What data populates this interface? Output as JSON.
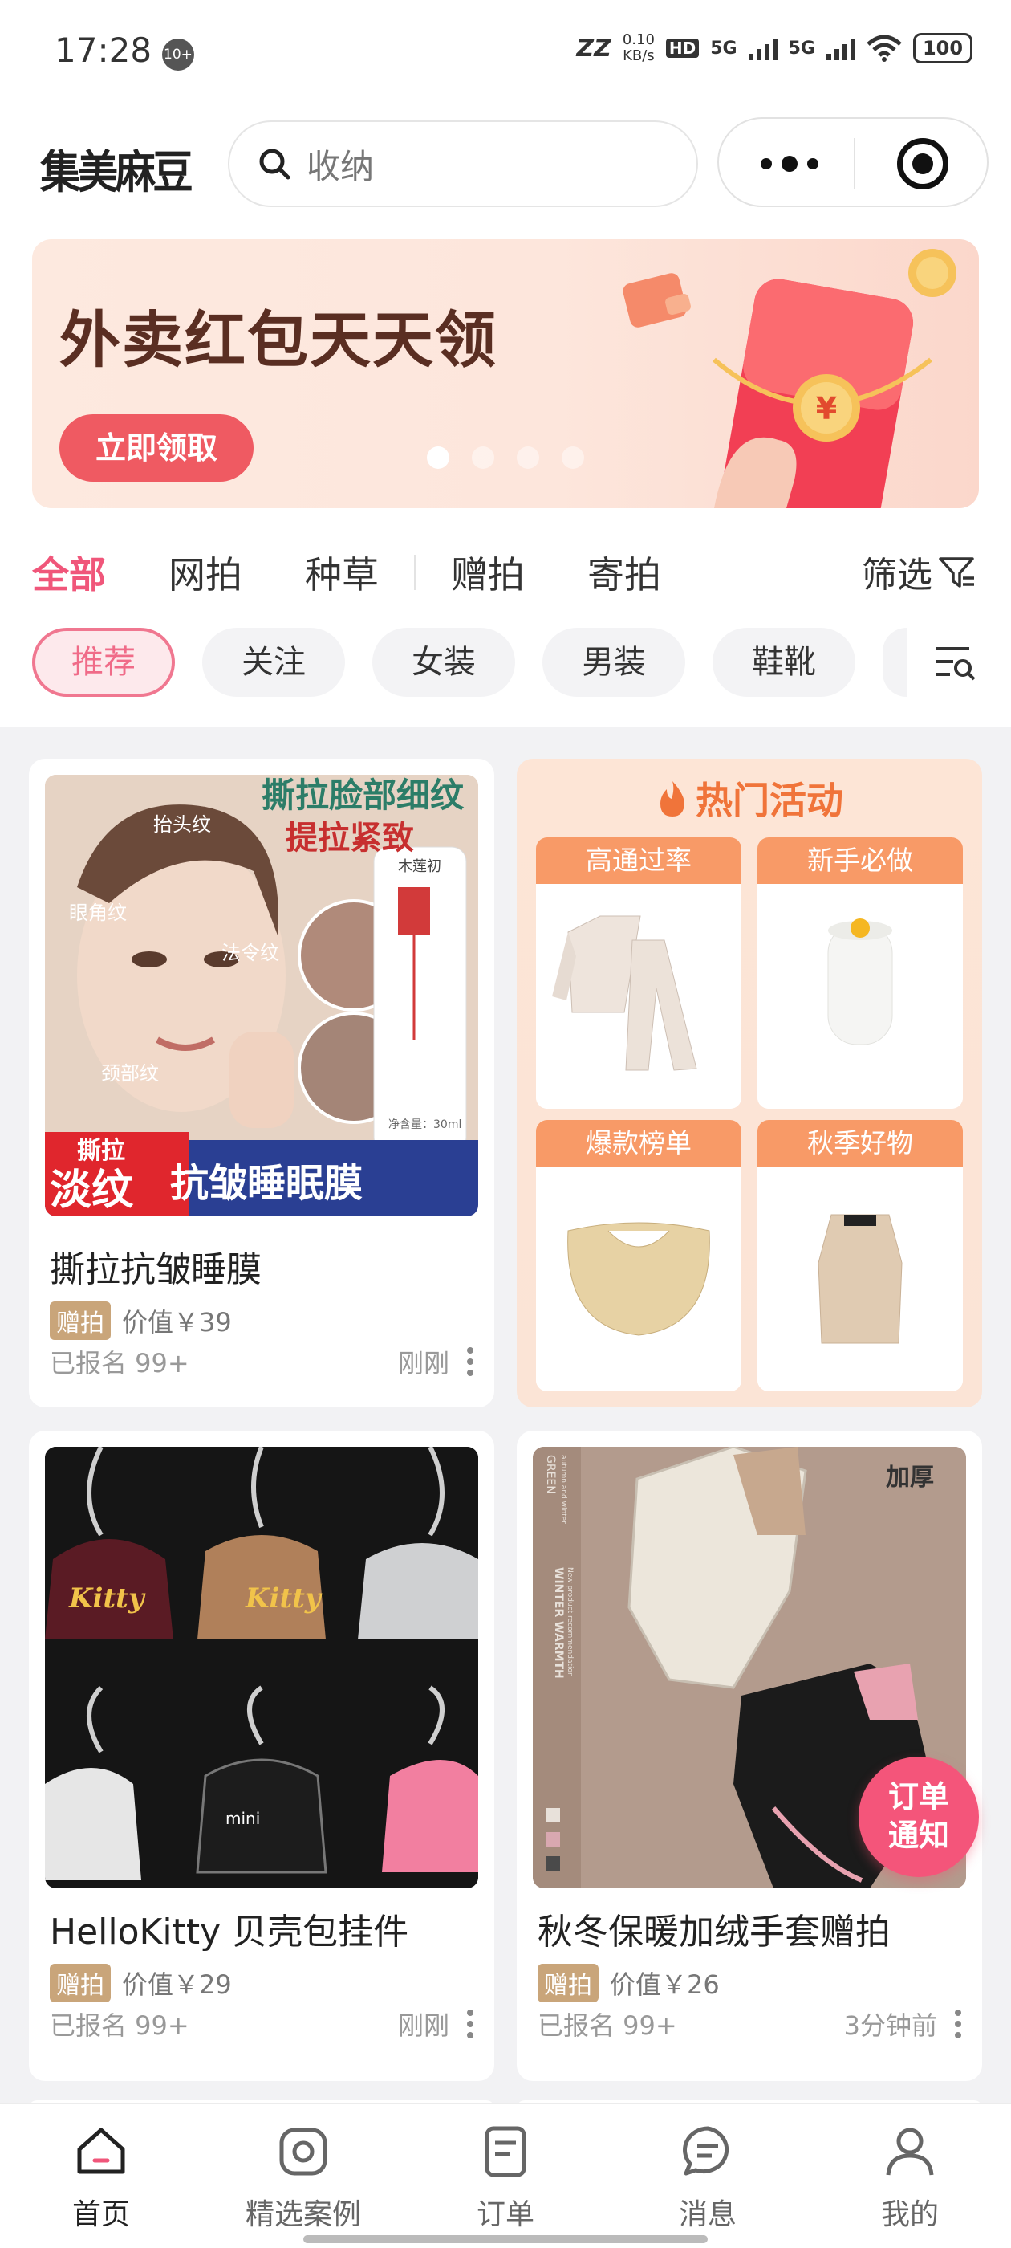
{
  "status_bar": {
    "time": "17:28",
    "notification_badge": "10+",
    "net_speed_value": "0.10",
    "net_speed_unit": "KB/s",
    "hd_label": "HD",
    "signal_1": "5G",
    "signal_2": "5G",
    "battery": "100"
  },
  "header": {
    "logo": "集美麻豆",
    "search_placeholder": "收纳"
  },
  "banner": {
    "title": "外卖红包天天领",
    "button": "立即领取",
    "active_index": 0,
    "dot_count": 4
  },
  "tabs": [
    "全部",
    "网拍",
    "种草",
    "赠拍",
    "寄拍"
  ],
  "filter_label": "筛选",
  "chips": [
    "推荐",
    "关注",
    "女装",
    "男装",
    "鞋靴"
  ],
  "product_1": {
    "title": "撕拉抗皱睡膜",
    "tag": "赠拍",
    "price": "价值￥39",
    "signups": "已报名 99+",
    "time": "刚刚",
    "img": {
      "headline_1": "撕拉脸部细纹",
      "headline_2": "提拉紧致",
      "label_forehead": "抬头纹",
      "label_eye": "眼角纹",
      "label_smile": "法令纹",
      "label_neck": "颈部纹",
      "brand": "木莲初",
      "volume": "净含量：30ml",
      "strip_small": "撕拉",
      "strip_red": "淡纹",
      "strip_blue": "抗皱睡眠膜"
    }
  },
  "hot_activity": {
    "title": "热门活动",
    "items": [
      "高通过率",
      "新手必做",
      "爆款榜单",
      "秋季好物"
    ]
  },
  "product_2": {
    "title": "HelloKitty 贝壳包挂件",
    "tag": "赠拍",
    "price": "价值￥29",
    "signups": "已报名 99+",
    "time": "刚刚",
    "img": {
      "kitty": "Kitty",
      "mini": "mini"
    }
  },
  "product_3": {
    "title": "秋冬保暖加绒手套赠拍",
    "tag": "赠拍",
    "price": "价值￥26",
    "signups": "已报名 99+",
    "time": "3分钟前",
    "img": {
      "corner": "加厚",
      "side_1": "GREEN",
      "side_2": "WINTER WARMTH",
      "side_3": "New product recommendation",
      "side_4": "autumn and winter"
    }
  },
  "order_bubble": {
    "line1": "订单",
    "line2": "通知"
  },
  "bottom_nav": [
    "首页",
    "精选案例",
    "订单",
    "消息",
    "我的"
  ],
  "colors": {
    "accent": "#f0567a",
    "tag": "#c9a57a",
    "hot": "#f0743a"
  }
}
